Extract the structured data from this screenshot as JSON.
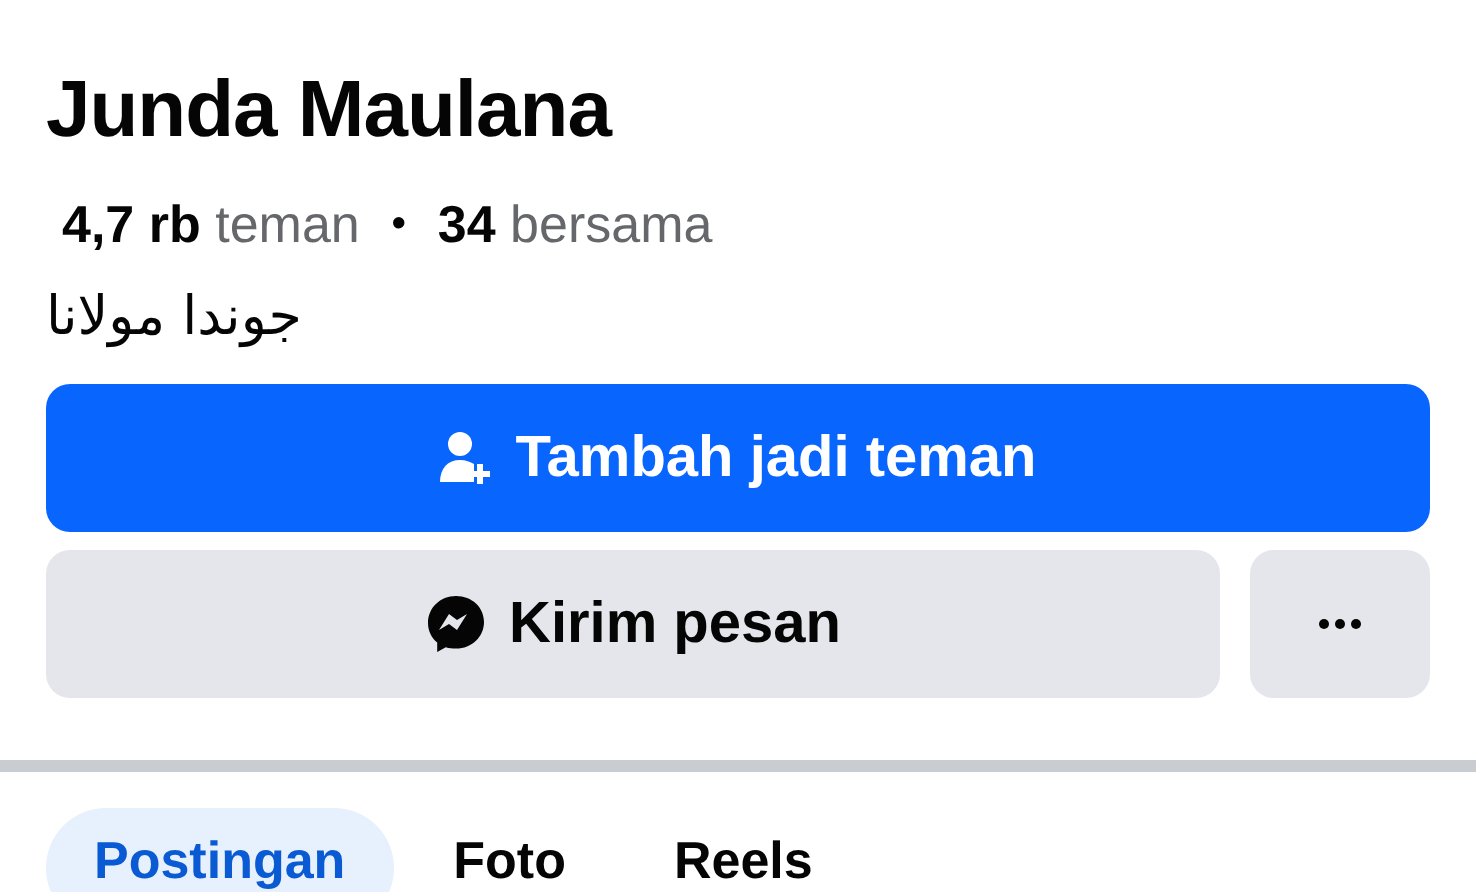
{
  "profile": {
    "name": "Junda Maulana",
    "stats": [
      "**4,7 rb** teman",
      "**34** bersama"
    ],
    "separator": "•",
    "alt_name": "جوندا مولانا"
  },
  "actions": [
    {
      "kind": "primary",
      "label": "Tambah jadi teman"
    },
    {
      "kind": "secondary",
      "label": "Kirim pesan"
    },
    {
      "kind": "more"
    }
  ],
  "tabs": [
    {
      "label": "Postingan",
      "selected": true
    },
    {
      "label": "Foto",
      "selected": false
    },
    {
      "label": "Reels",
      "selected": false
    }
  ]
}
